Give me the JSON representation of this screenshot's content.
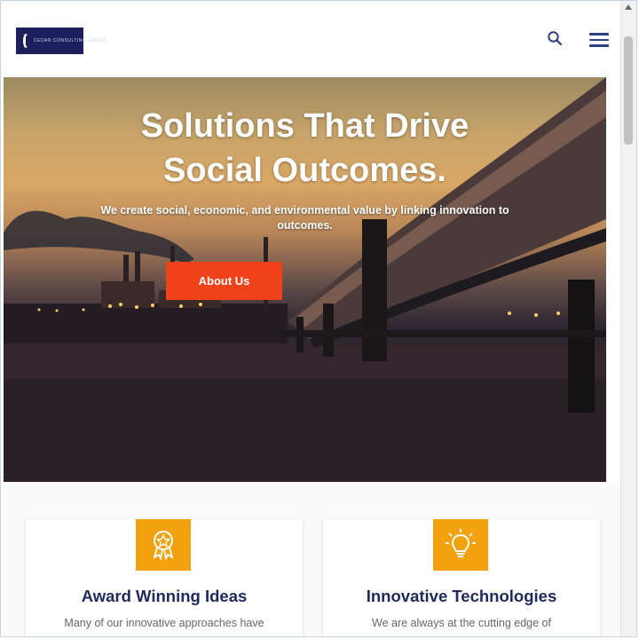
{
  "header": {
    "logo_text": "CEDAR CONSULTING GROUP",
    "search_icon": "search-icon",
    "menu_icon": "hamburger-menu-icon"
  },
  "hero": {
    "title_line1": "Solutions That Drive",
    "title_line2": "Social Outcomes.",
    "subtitle": "We create social, economic, and environmental value by linking innovation to outcomes.",
    "button_label": "About Us"
  },
  "features": [
    {
      "icon": "award-medal-icon",
      "title": "Award Winning Ideas",
      "text": "Many of our innovative approaches have"
    },
    {
      "icon": "lightbulb-icon",
      "title": "Innovative Technologies",
      "text": "We are always at the cutting edge of"
    }
  ],
  "colors": {
    "accent_button": "#f0421a",
    "icon_box": "#f3a20f",
    "heading": "#1e2a5e",
    "logo_bg": "#1b1f5c",
    "nav_icon": "#2d3f87"
  }
}
